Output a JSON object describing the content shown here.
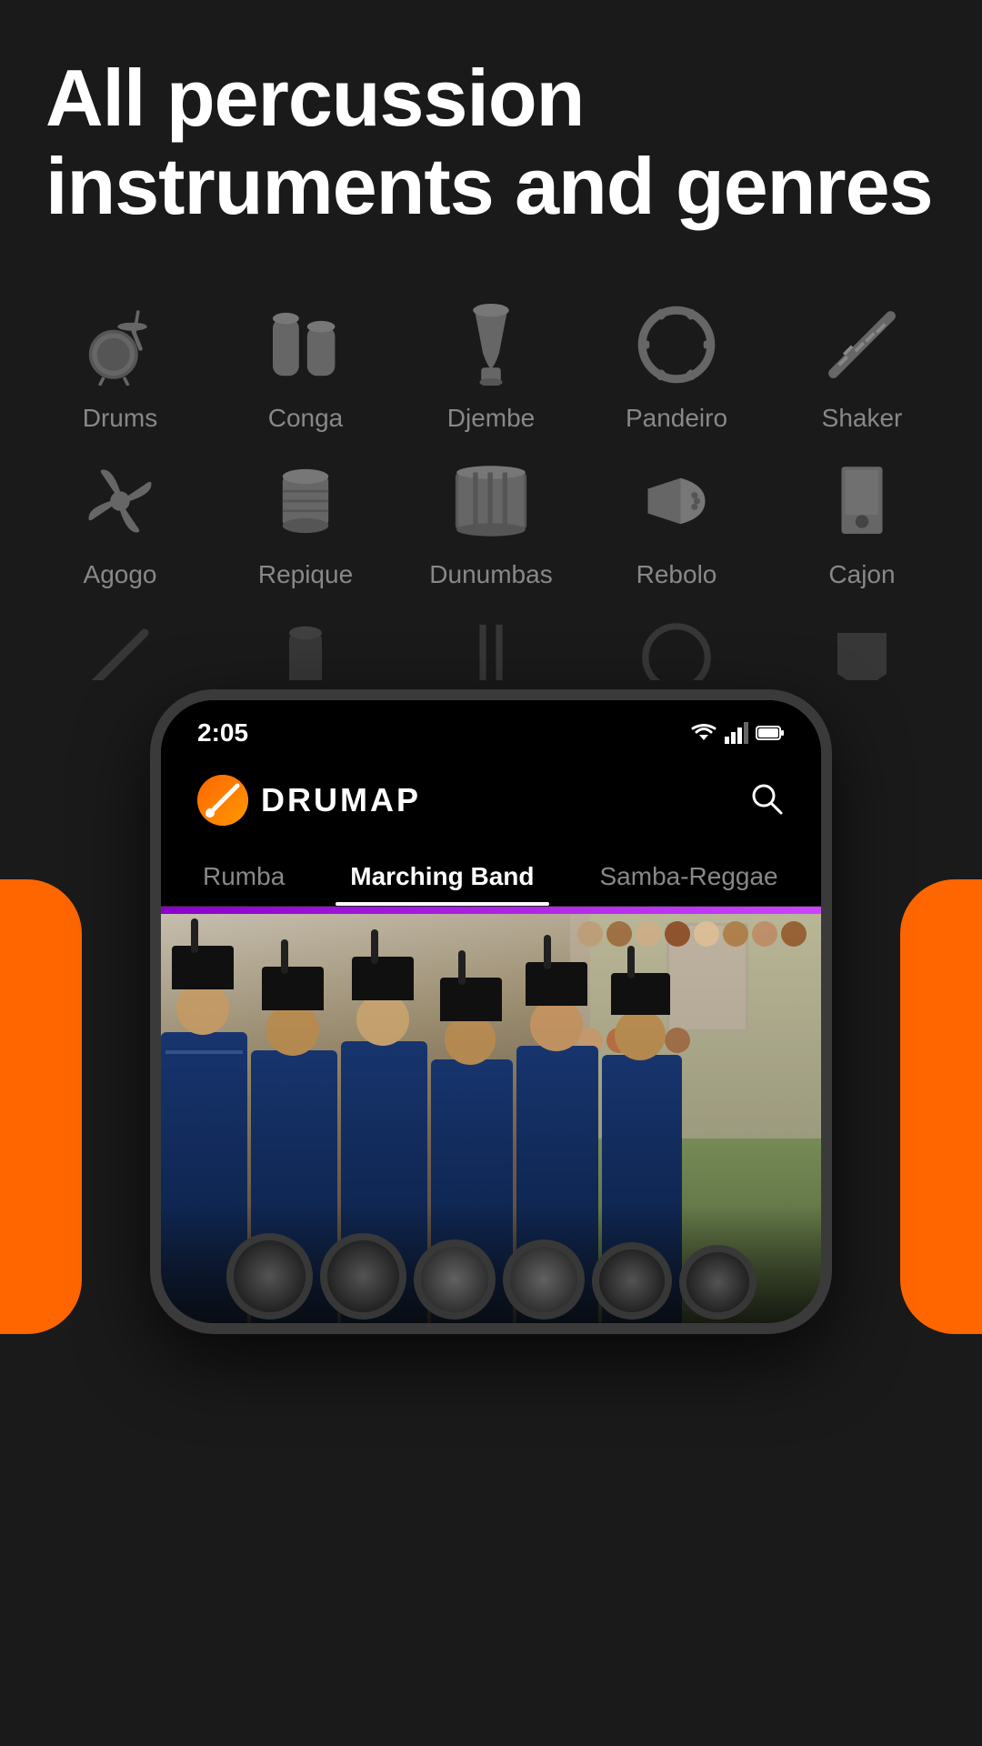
{
  "hero": {
    "title": "All percussion instruments and genres"
  },
  "instruments": {
    "row1": [
      {
        "id": "drums",
        "label": "Drums",
        "icon": "drums"
      },
      {
        "id": "conga",
        "label": "Conga",
        "icon": "conga"
      },
      {
        "id": "djembe",
        "label": "Djembe",
        "icon": "djembe"
      },
      {
        "id": "pandeiro",
        "label": "Pandeiro",
        "icon": "pandeiro"
      },
      {
        "id": "shaker",
        "label": "Shaker",
        "icon": "shaker"
      }
    ],
    "row2": [
      {
        "id": "agogo",
        "label": "Agogo",
        "icon": "agogo"
      },
      {
        "id": "repique",
        "label": "Repique",
        "icon": "repique"
      },
      {
        "id": "dunumbas",
        "label": "Dunumbas",
        "icon": "dunumbas"
      },
      {
        "id": "rebolo",
        "label": "Rebolo",
        "icon": "rebolo"
      },
      {
        "id": "cajon",
        "label": "Cajon",
        "icon": "cajon"
      }
    ]
  },
  "phone": {
    "status_time": "2:05",
    "app_name": "DRUMAP",
    "search_label": "Search",
    "tabs": [
      {
        "id": "rumba",
        "label": "Rumba",
        "active": false
      },
      {
        "id": "marching-band",
        "label": "Marching Band",
        "active": true
      },
      {
        "id": "samba-reggae",
        "label": "Samba-Reggae",
        "active": false
      }
    ],
    "content_genre": "Marching Band"
  },
  "colors": {
    "background": "#1a1a1a",
    "accent_orange": "#FF6600",
    "text_primary": "#ffffff",
    "text_muted": "#888888",
    "icon_color": "#666666"
  }
}
